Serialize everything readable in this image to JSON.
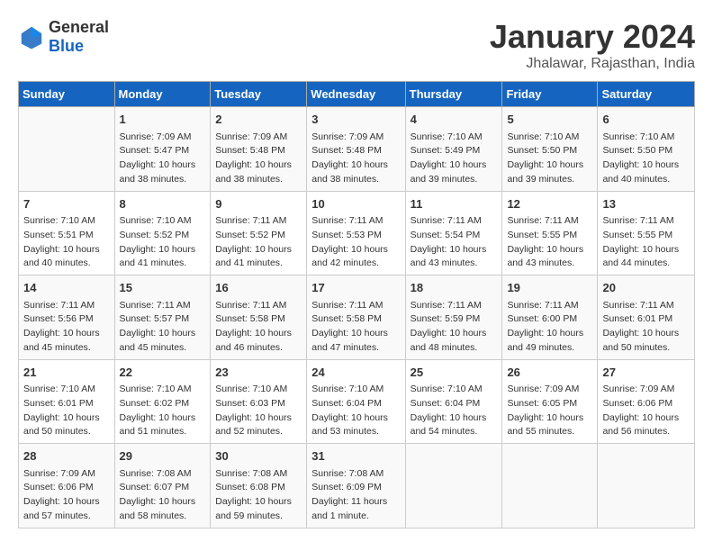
{
  "logo": {
    "general": "General",
    "blue": "Blue"
  },
  "title": "January 2024",
  "subtitle": "Jhalawar, Rajasthan, India",
  "headers": [
    "Sunday",
    "Monday",
    "Tuesday",
    "Wednesday",
    "Thursday",
    "Friday",
    "Saturday"
  ],
  "weeks": [
    [
      {
        "day": "",
        "info": ""
      },
      {
        "day": "1",
        "info": "Sunrise: 7:09 AM\nSunset: 5:47 PM\nDaylight: 10 hours\nand 38 minutes."
      },
      {
        "day": "2",
        "info": "Sunrise: 7:09 AM\nSunset: 5:48 PM\nDaylight: 10 hours\nand 38 minutes."
      },
      {
        "day": "3",
        "info": "Sunrise: 7:09 AM\nSunset: 5:48 PM\nDaylight: 10 hours\nand 38 minutes."
      },
      {
        "day": "4",
        "info": "Sunrise: 7:10 AM\nSunset: 5:49 PM\nDaylight: 10 hours\nand 39 minutes."
      },
      {
        "day": "5",
        "info": "Sunrise: 7:10 AM\nSunset: 5:50 PM\nDaylight: 10 hours\nand 39 minutes."
      },
      {
        "day": "6",
        "info": "Sunrise: 7:10 AM\nSunset: 5:50 PM\nDaylight: 10 hours\nand 40 minutes."
      }
    ],
    [
      {
        "day": "7",
        "info": "Sunrise: 7:10 AM\nSunset: 5:51 PM\nDaylight: 10 hours\nand 40 minutes."
      },
      {
        "day": "8",
        "info": "Sunrise: 7:10 AM\nSunset: 5:52 PM\nDaylight: 10 hours\nand 41 minutes."
      },
      {
        "day": "9",
        "info": "Sunrise: 7:11 AM\nSunset: 5:52 PM\nDaylight: 10 hours\nand 41 minutes."
      },
      {
        "day": "10",
        "info": "Sunrise: 7:11 AM\nSunset: 5:53 PM\nDaylight: 10 hours\nand 42 minutes."
      },
      {
        "day": "11",
        "info": "Sunrise: 7:11 AM\nSunset: 5:54 PM\nDaylight: 10 hours\nand 43 minutes."
      },
      {
        "day": "12",
        "info": "Sunrise: 7:11 AM\nSunset: 5:55 PM\nDaylight: 10 hours\nand 43 minutes."
      },
      {
        "day": "13",
        "info": "Sunrise: 7:11 AM\nSunset: 5:55 PM\nDaylight: 10 hours\nand 44 minutes."
      }
    ],
    [
      {
        "day": "14",
        "info": "Sunrise: 7:11 AM\nSunset: 5:56 PM\nDaylight: 10 hours\nand 45 minutes."
      },
      {
        "day": "15",
        "info": "Sunrise: 7:11 AM\nSunset: 5:57 PM\nDaylight: 10 hours\nand 45 minutes."
      },
      {
        "day": "16",
        "info": "Sunrise: 7:11 AM\nSunset: 5:58 PM\nDaylight: 10 hours\nand 46 minutes."
      },
      {
        "day": "17",
        "info": "Sunrise: 7:11 AM\nSunset: 5:58 PM\nDaylight: 10 hours\nand 47 minutes."
      },
      {
        "day": "18",
        "info": "Sunrise: 7:11 AM\nSunset: 5:59 PM\nDaylight: 10 hours\nand 48 minutes."
      },
      {
        "day": "19",
        "info": "Sunrise: 7:11 AM\nSunset: 6:00 PM\nDaylight: 10 hours\nand 49 minutes."
      },
      {
        "day": "20",
        "info": "Sunrise: 7:11 AM\nSunset: 6:01 PM\nDaylight: 10 hours\nand 50 minutes."
      }
    ],
    [
      {
        "day": "21",
        "info": "Sunrise: 7:10 AM\nSunset: 6:01 PM\nDaylight: 10 hours\nand 50 minutes."
      },
      {
        "day": "22",
        "info": "Sunrise: 7:10 AM\nSunset: 6:02 PM\nDaylight: 10 hours\nand 51 minutes."
      },
      {
        "day": "23",
        "info": "Sunrise: 7:10 AM\nSunset: 6:03 PM\nDaylight: 10 hours\nand 52 minutes."
      },
      {
        "day": "24",
        "info": "Sunrise: 7:10 AM\nSunset: 6:04 PM\nDaylight: 10 hours\nand 53 minutes."
      },
      {
        "day": "25",
        "info": "Sunrise: 7:10 AM\nSunset: 6:04 PM\nDaylight: 10 hours\nand 54 minutes."
      },
      {
        "day": "26",
        "info": "Sunrise: 7:09 AM\nSunset: 6:05 PM\nDaylight: 10 hours\nand 55 minutes."
      },
      {
        "day": "27",
        "info": "Sunrise: 7:09 AM\nSunset: 6:06 PM\nDaylight: 10 hours\nand 56 minutes."
      }
    ],
    [
      {
        "day": "28",
        "info": "Sunrise: 7:09 AM\nSunset: 6:06 PM\nDaylight: 10 hours\nand 57 minutes."
      },
      {
        "day": "29",
        "info": "Sunrise: 7:08 AM\nSunset: 6:07 PM\nDaylight: 10 hours\nand 58 minutes."
      },
      {
        "day": "30",
        "info": "Sunrise: 7:08 AM\nSunset: 6:08 PM\nDaylight: 10 hours\nand 59 minutes."
      },
      {
        "day": "31",
        "info": "Sunrise: 7:08 AM\nSunset: 6:09 PM\nDaylight: 11 hours\nand 1 minute."
      },
      {
        "day": "",
        "info": ""
      },
      {
        "day": "",
        "info": ""
      },
      {
        "day": "",
        "info": ""
      }
    ]
  ]
}
